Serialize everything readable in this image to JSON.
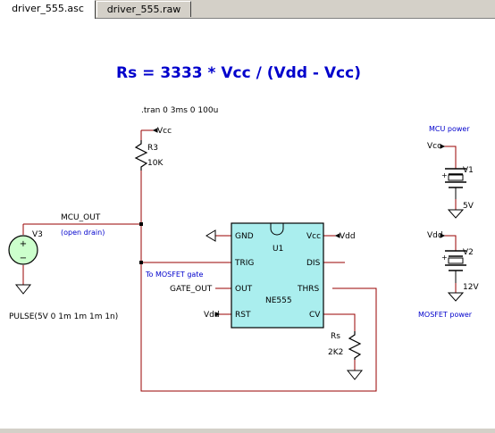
{
  "tabs": [
    {
      "label": "driver_555.asc"
    },
    {
      "label": "driver_555.raw"
    }
  ],
  "schematic": {
    "title": "Rs = 3333 * Vcc / (Vdd - Vcc)",
    "tran_directive": ".tran 0 3ms 0 100u",
    "labels": {
      "vcc_r3": "Vcc",
      "r3_name": "R3",
      "r3_value": "10K",
      "mcu_out": "MCU_OUT",
      "open_drain": "(open drain)",
      "v3_name": "V3",
      "pulse": "PULSE(5V 0 1m 1m 1m 1n)",
      "to_mosfet_gate": "To MOSFET gate",
      "gate_out": "GATE_OUT",
      "vdd_rst": "Vdd",
      "vdd_vcc": "Vdd",
      "rs_name": "Rs",
      "rs_value": "2K2",
      "mcu_power": "MCU power",
      "vcc_v1": "Vcc",
      "v1_name": "V1",
      "v1_value": "5V",
      "vdd_v2": "Vdd",
      "v2_name": "V2",
      "v2_value": "12V",
      "mosfet_power": "MOSFET power"
    },
    "ic": {
      "name": "U1",
      "model": "NE555",
      "pins": {
        "gnd": "GND",
        "vcc": "Vcc",
        "trig": "TRIG",
        "dis": "DIS",
        "out": "OUT",
        "thrs": "THRS",
        "rst": "RST",
        "cv": "CV"
      }
    },
    "colors": {
      "wire": "#990000",
      "component": "#000000",
      "ic_fill": "#aaeeee",
      "blue_text": "#0000cc",
      "v_fill": "#ccffcc"
    }
  }
}
